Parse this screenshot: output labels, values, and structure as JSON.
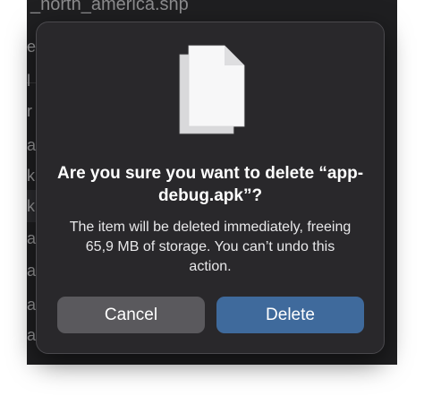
{
  "background_window": {
    "title": "_north_america.shp",
    "fragments": [
      "e",
      "l",
      "r",
      "a",
      "k",
      "k",
      "a",
      "a",
      "a",
      "a"
    ]
  },
  "dialog": {
    "icon": "document-icon",
    "title": "Are you sure you want to delete “app-debug.apk”?",
    "message": "The item will be deleted immediately, freeing 65,9 MB of storage. You can’t undo this action.",
    "cancel_label": "Cancel",
    "delete_label": "Delete"
  },
  "colors": {
    "dialog_bg": "#29282b",
    "cancel_bg": "#5a595d",
    "delete_bg": "#3f6a9c"
  }
}
